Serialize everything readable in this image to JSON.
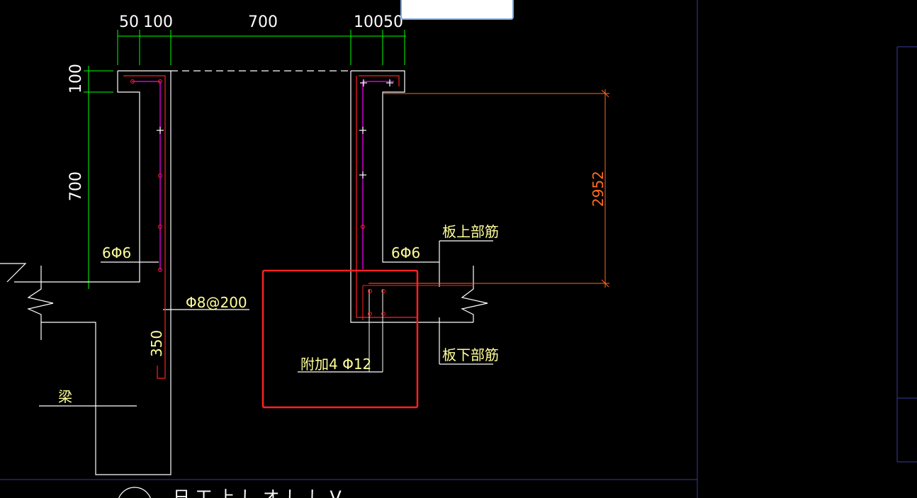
{
  "dims": {
    "top_50_left": "50",
    "top_100_left": "100",
    "top_700": "700",
    "top_100_right": "100",
    "top_50_right": "50",
    "left_100": "100",
    "left_700": "700",
    "right_2952": "2952",
    "vertical_350": "350"
  },
  "labels": {
    "rebar_left": "6Φ6",
    "rebar_right": "6Φ6",
    "stirrup": "Φ8@200",
    "additional": "附加4 Φ12",
    "slab_top": "板上部筋",
    "slab_bottom": "板下部筋",
    "beam": "梁",
    "bottom_partial": "日 工 上 し オ し し V"
  },
  "tooltip": {
    "text": "····"
  },
  "colors": {
    "background": "#000000",
    "outline": "#ffffff",
    "dimension": "#00ff00",
    "rebar_magenta": "#ff00ff",
    "rebar_red": "#ff2020",
    "orange_dim": "#ff6a20",
    "text_yellow": "#ffff99",
    "highlight_box": "#ff2222",
    "panel_border": "#3a3aa0"
  }
}
